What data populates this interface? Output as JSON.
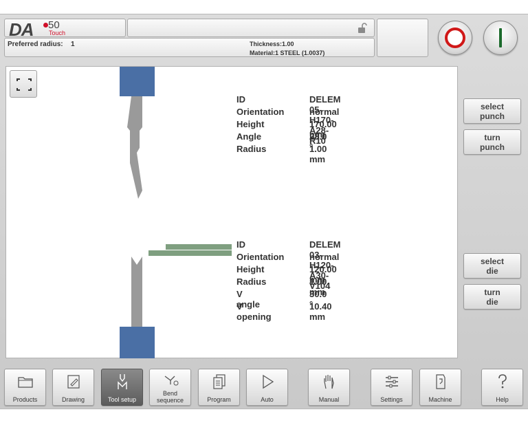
{
  "header": {
    "logo": {
      "brand": "DA",
      "model": "50",
      "edition": "Touch"
    },
    "preferred_radius_label": "Preferred radius:",
    "preferred_radius_value": "1",
    "thickness": "Thickness:1.00",
    "material": "Material:1 STEEL (1.0037)"
  },
  "punch": {
    "rows": [
      {
        "label": "ID",
        "value": "DELEM 05-H170-A28-R10"
      },
      {
        "label": "Orientation",
        "value": "normal"
      },
      {
        "label": "Height",
        "value": "170.00 mm"
      },
      {
        "label": "Angle",
        "value": "28.0 °"
      },
      {
        "label": "Radius",
        "value": "1.00 mm"
      }
    ]
  },
  "die": {
    "rows": [
      {
        "label": "ID",
        "value": "DELEM 03-H120-A30-V104"
      },
      {
        "label": "Orientation",
        "value": "normal"
      },
      {
        "label": "Height",
        "value": "120.00 mm"
      },
      {
        "label": "Radius",
        "value": "1.00 mm"
      },
      {
        "label": "V angle",
        "value": "30.0 °"
      },
      {
        "label": "V opening",
        "value": "10.40 mm"
      }
    ]
  },
  "side_buttons": {
    "select_punch": [
      "select",
      "punch"
    ],
    "turn_punch": [
      "turn",
      "punch"
    ],
    "select_die": [
      "select",
      "die"
    ],
    "turn_die": [
      "turn",
      "die"
    ]
  },
  "nav": [
    {
      "label": "Products",
      "icon": "folder-icon"
    },
    {
      "label": "Drawing",
      "icon": "pencil-icon"
    },
    {
      "label": "Tool setup",
      "icon": "tool-setup-icon",
      "active": true
    },
    {
      "label": "Bend\nsequence",
      "icon": "bend-sequence-icon"
    },
    {
      "label": "Program",
      "icon": "program-icon"
    },
    {
      "label": "Auto",
      "icon": "play-icon"
    },
    {
      "label": "Manual",
      "icon": "hand-icon"
    },
    {
      "label": "Settings",
      "icon": "settings-list-icon"
    },
    {
      "label": "Machine",
      "icon": "machine-icon"
    },
    {
      "label": "Help",
      "icon": "help-icon"
    }
  ],
  "colors": {
    "tool_holder": "#4a6fa5",
    "tool_body": "#9a9a9a",
    "sheet": "#7f9f80",
    "stop": "#d01818",
    "start": "#1c6a2c"
  }
}
